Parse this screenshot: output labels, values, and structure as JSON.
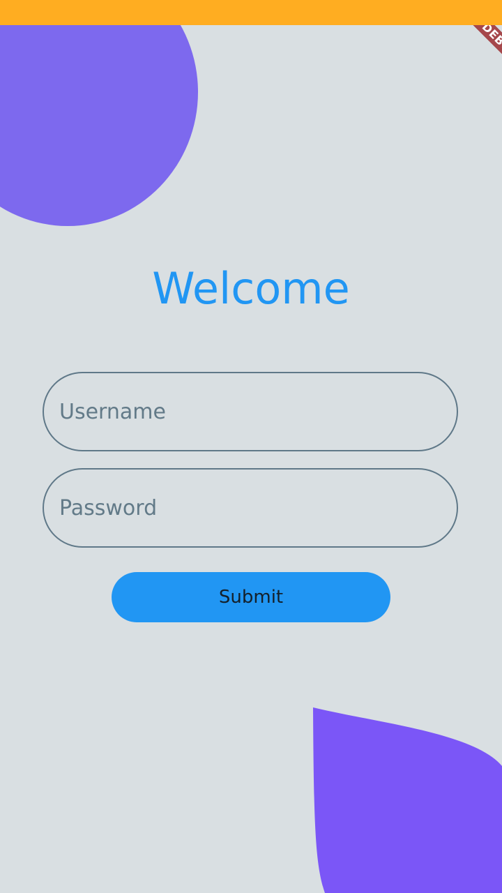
{
  "status_bar": {
    "color": "#ffad21"
  },
  "debug_banner": {
    "label": "DEBUG",
    "color": "#a5474b"
  },
  "decor": {
    "top_blob_color": "#7d69ee",
    "bottom_blob_color": "#7b56f7"
  },
  "welcome": {
    "title": "Welcome",
    "color": "#2196f3"
  },
  "form": {
    "username": {
      "placeholder": "Username",
      "value": ""
    },
    "password": {
      "placeholder": "Password",
      "value": ""
    },
    "submit": {
      "label": "Submit",
      "color": "#2196f3"
    }
  }
}
